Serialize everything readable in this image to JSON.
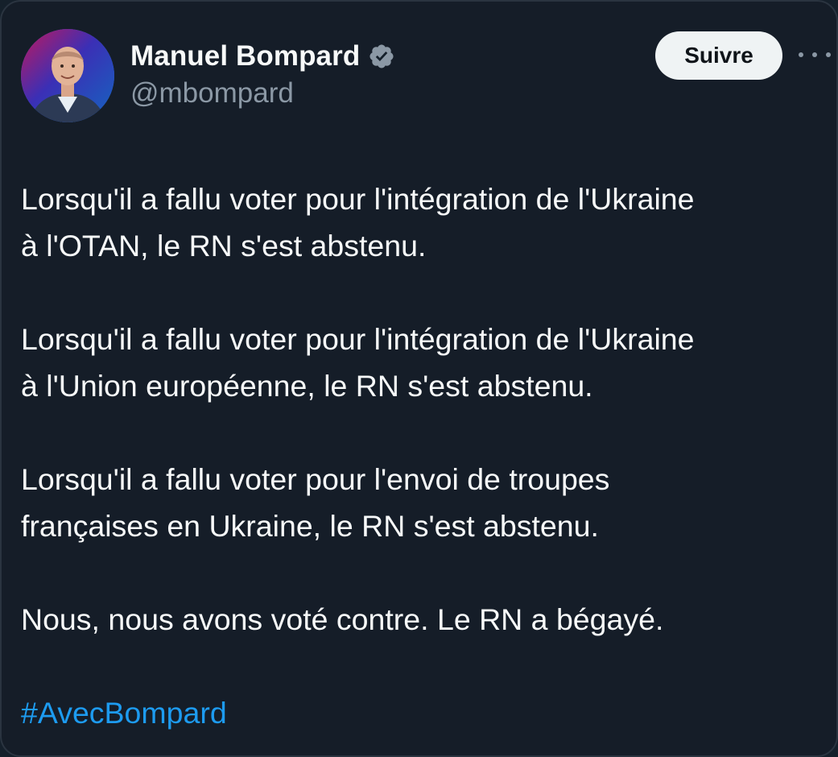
{
  "author": {
    "display_name": "Manuel Bompard",
    "handle": "@mbompard",
    "verified": true,
    "avatar_icon": "profile-photo"
  },
  "actions": {
    "follow_label": "Suivre",
    "more_icon": "more-horizontal-icon"
  },
  "tweet": {
    "paragraphs": [
      "Lorsqu'il a fallu voter pour l'intégration de l'Ukraine\nà l'OTAN, le RN s'est abstenu.",
      "Lorsqu'il a fallu voter pour l'intégration de l'Ukraine\nà l'Union européenne, le RN s'est abstenu.",
      "Lorsqu'il a fallu voter pour l'envoi de troupes\nfrançaises en Ukraine, le RN s'est abstenu.",
      "Nous, nous avons voté contre. Le RN a bégayé."
    ],
    "hashtag": "#AvecBompard"
  },
  "colors": {
    "background": "#15202b",
    "text": "#f7f9f9",
    "secondary_text": "#8b98a5",
    "link": "#1d9bf0",
    "verified_badge": "#8b98a5"
  }
}
